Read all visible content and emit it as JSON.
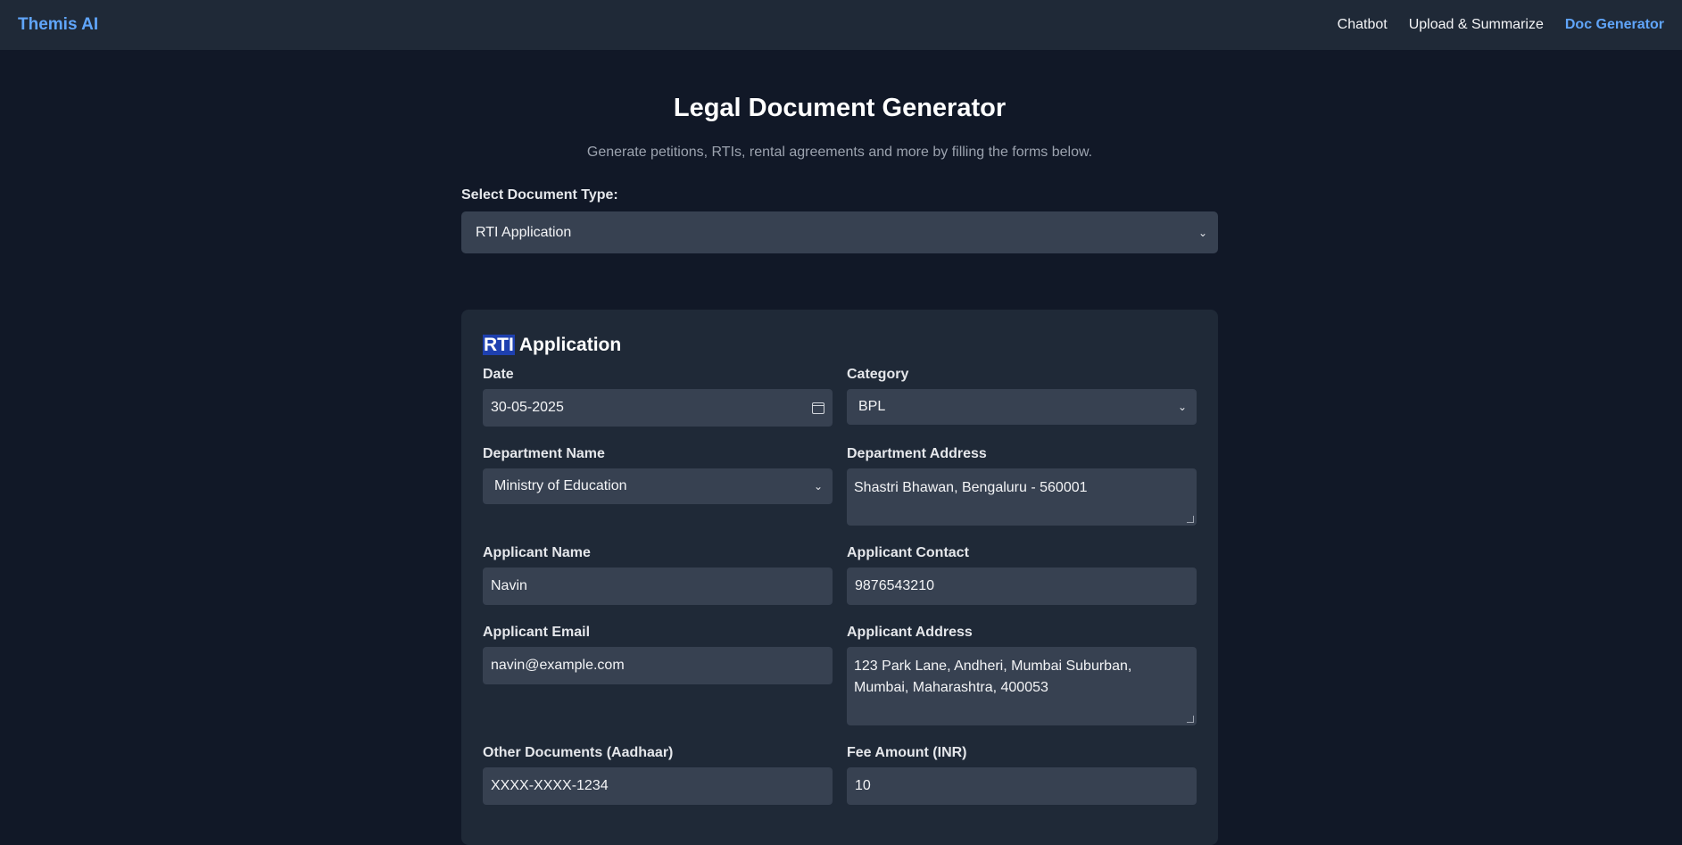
{
  "nav": {
    "brand": "Themis AI",
    "links": [
      "Chatbot",
      "Upload & Summarize",
      "Doc Generator"
    ],
    "active": "Doc Generator"
  },
  "page": {
    "title": "Legal Document Generator",
    "subtitle": "Generate petitions, RTIs, rental agreements and more by filling the forms below.",
    "select_label": "Select Document Type:",
    "selected_doc_type": "RTI Application"
  },
  "form": {
    "title_highlight": "RTI",
    "title_rest": " Application",
    "date": {
      "label": "Date",
      "value": "30-05-2025"
    },
    "category": {
      "label": "Category",
      "value": "BPL"
    },
    "department_name": {
      "label": "Department Name",
      "value": "Ministry of Education"
    },
    "department_address": {
      "label": "Department Address",
      "value": "Shastri Bhawan, Bengaluru - 560001"
    },
    "applicant_name": {
      "label": "Applicant Name",
      "value": "Navin"
    },
    "applicant_contact": {
      "label": "Applicant Contact",
      "value": "9876543210"
    },
    "applicant_email": {
      "label": "Applicant Email",
      "value": "navin@example.com"
    },
    "applicant_address": {
      "label": "Applicant Address",
      "value": "123 Park Lane, Andheri, Mumbai Suburban, Mumbai, Maharashtra, 400053"
    },
    "other_documents": {
      "label": "Other Documents (Aadhaar)",
      "value": "XXXX-XXXX-1234"
    },
    "fee_amount": {
      "label": "Fee Amount (INR)",
      "value": "10"
    }
  },
  "colors": {
    "background": "#111827",
    "navbar": "#1f2937",
    "accent": "#60a5fa",
    "input": "#374151",
    "highlight": "#1e40af"
  },
  "icons": [
    "calendar-icon",
    "chevron-down-icon"
  ]
}
